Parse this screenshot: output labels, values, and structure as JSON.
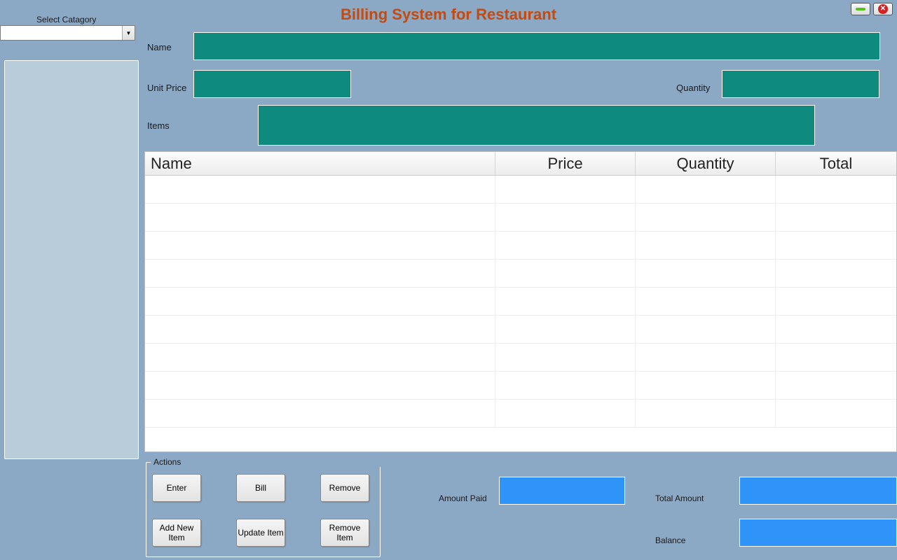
{
  "window": {
    "title": "Billing System for Restaurant"
  },
  "sidebar": {
    "category_label": "Select Catagory",
    "category_value": ""
  },
  "form": {
    "name_label": "Name",
    "name_value": "",
    "unit_price_label": "Unit Price",
    "unit_price_value": "",
    "quantity_label": "Quantity",
    "quantity_value": "",
    "items_label": "Items",
    "items_value": ""
  },
  "table": {
    "headers": {
      "name": "Name",
      "price": "Price",
      "quantity": "Quantity",
      "total": "Total"
    },
    "rows": []
  },
  "actions": {
    "group_label": "Actions",
    "enter": "Enter",
    "bill": "Bill",
    "remove": "Remove",
    "add_new_item": "Add New Item",
    "update_item": "Update Item",
    "remove_item": "Remove Item"
  },
  "summary": {
    "amount_paid_label": "Amount Paid",
    "amount_paid_value": "",
    "total_amount_label": "Total Amount",
    "total_amount_value": "",
    "balance_label": "Balance",
    "balance_value": ""
  },
  "colors": {
    "teal": "#0e8a7e",
    "blue": "#2f94f7",
    "bg": "#8ba8c4",
    "title": "#c44a10"
  }
}
